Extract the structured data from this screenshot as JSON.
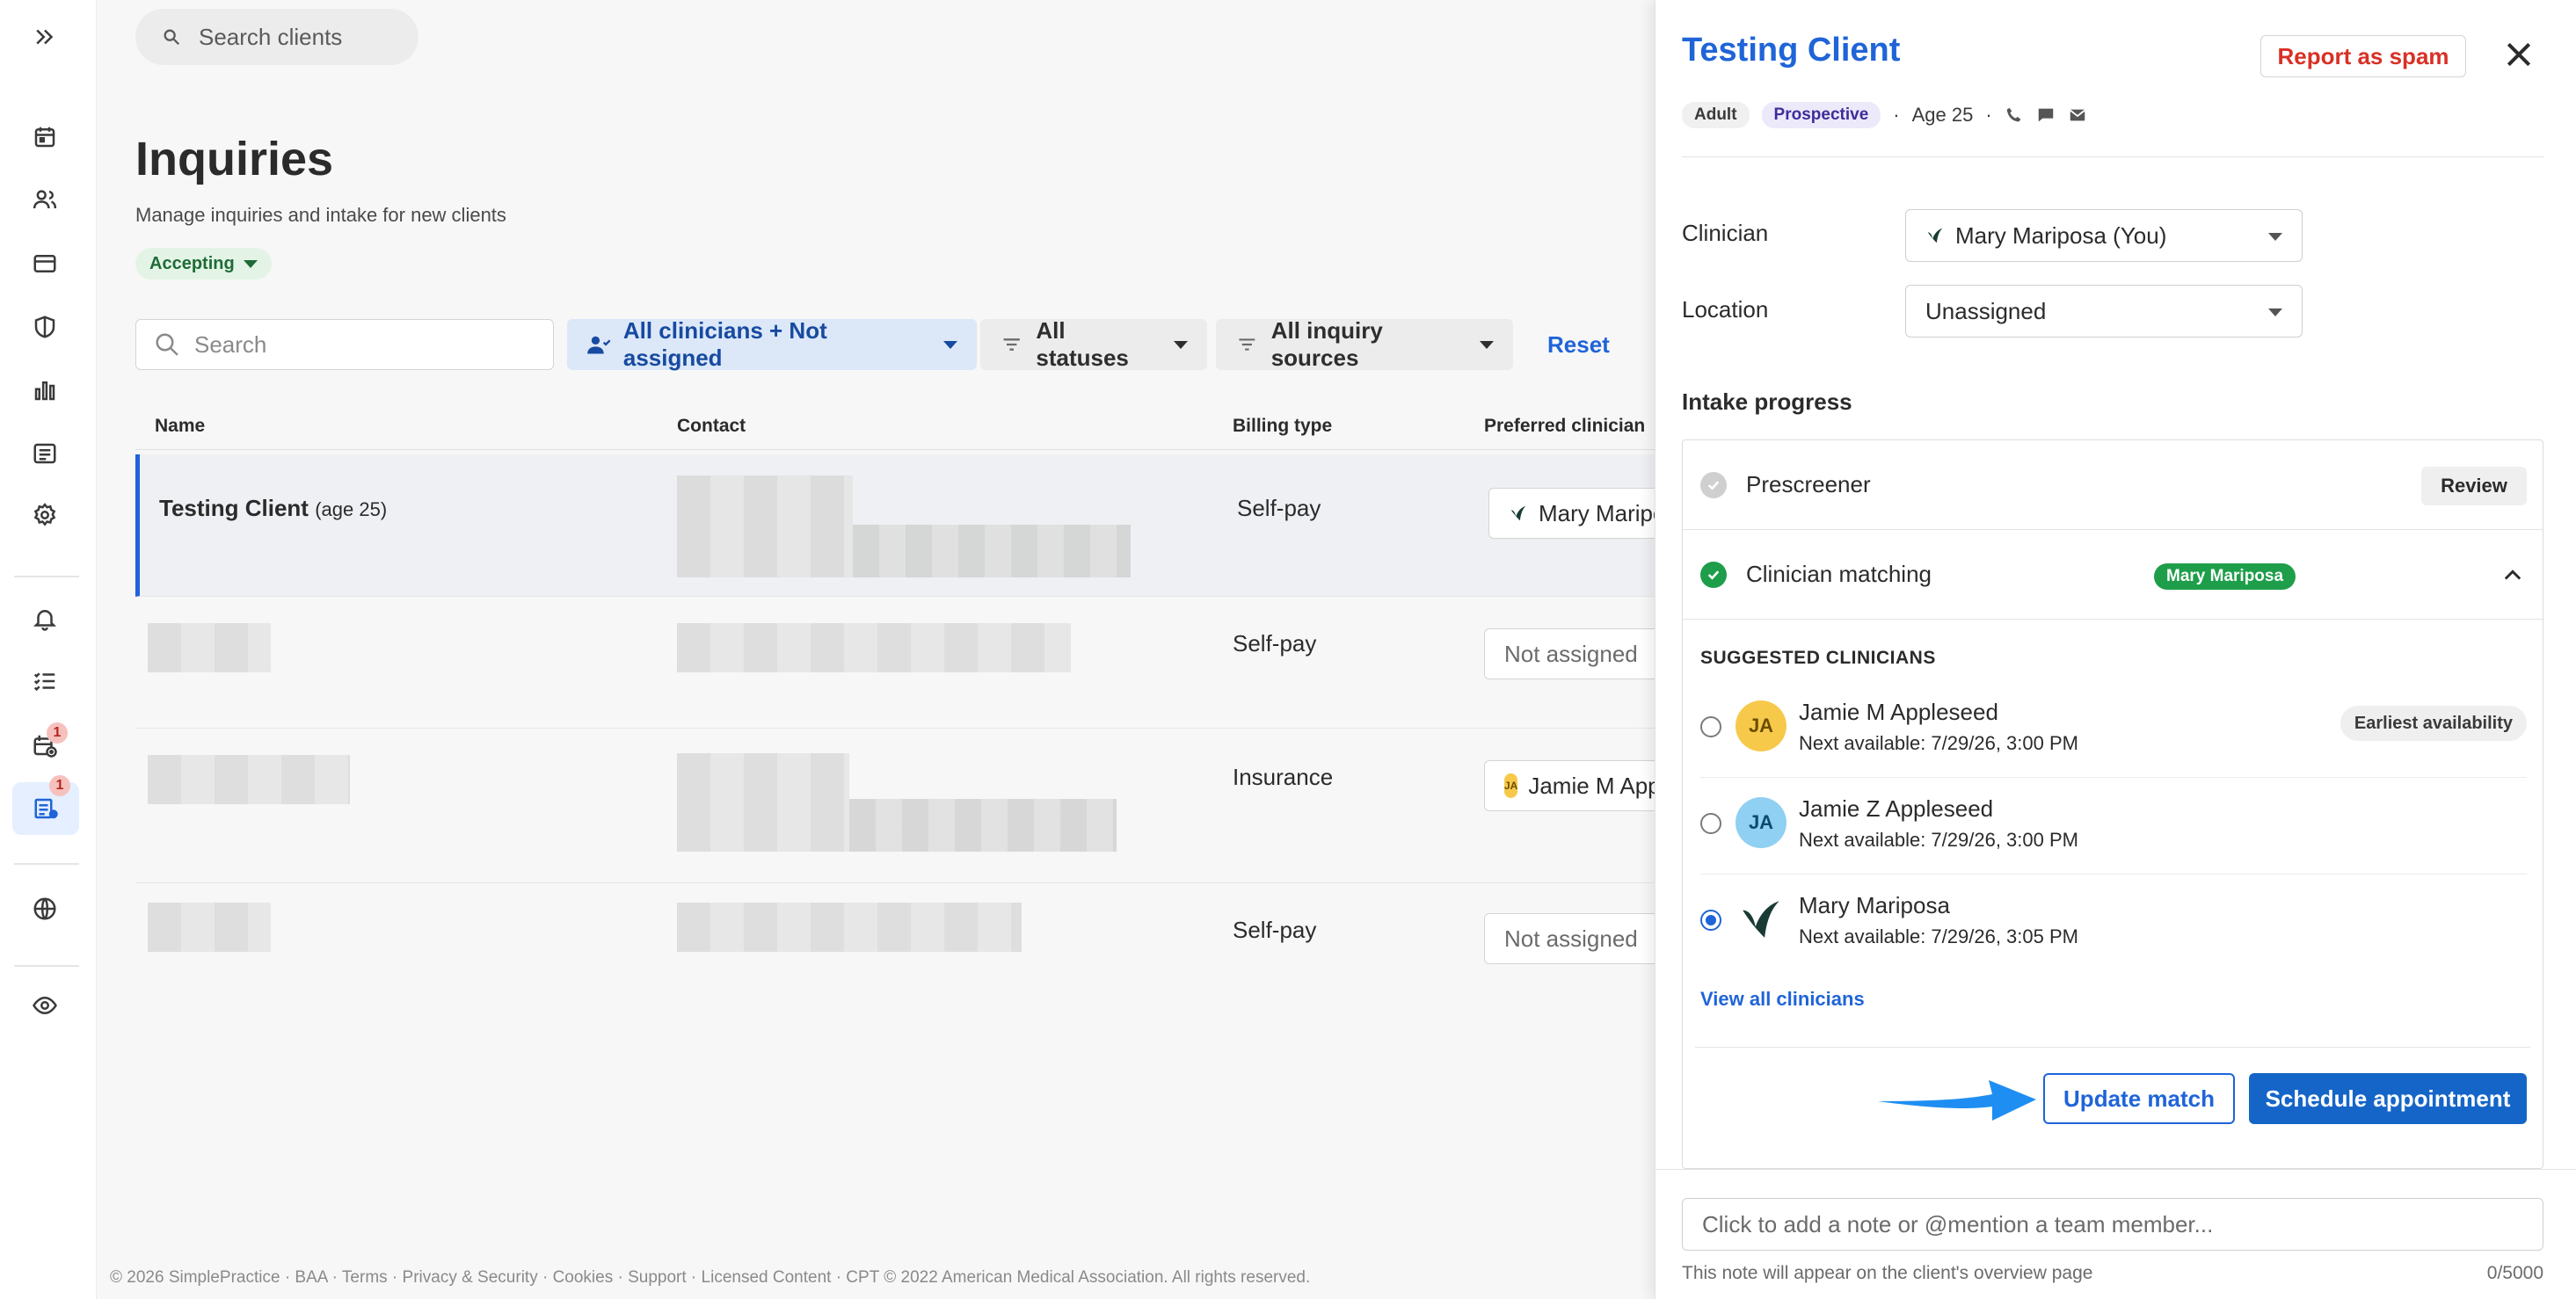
{
  "rail": {
    "items": [
      {
        "name": "expand-sidebar-icon"
      },
      {
        "name": "calendar-icon"
      },
      {
        "name": "clients-icon"
      },
      {
        "name": "billing-icon"
      },
      {
        "name": "insurance-icon"
      },
      {
        "name": "analytics-icon"
      },
      {
        "name": "documents-icon"
      },
      {
        "name": "settings-icon"
      },
      {
        "name": "notifications-icon"
      },
      {
        "name": "tasks-icon"
      },
      {
        "name": "requests-icon",
        "badge": "1"
      },
      {
        "name": "inquiries-icon",
        "badge": "1",
        "active": true
      },
      {
        "name": "website-icon"
      },
      {
        "name": "preview-icon"
      }
    ]
  },
  "topbar": {
    "search_placeholder": "Search clients"
  },
  "page": {
    "title": "Inquiries",
    "subtitle": "Manage inquiries and intake for new clients",
    "accepting_label": "Accepting"
  },
  "filters": {
    "search_placeholder": "Search",
    "clinicians": "All clinicians + Not assigned",
    "statuses": "All statuses",
    "sources": "All inquiry sources",
    "reset": "Reset"
  },
  "table": {
    "headers": [
      "Name",
      "Contact",
      "Billing type",
      "Preferred clinician"
    ],
    "rows": [
      {
        "name": "Testing Client",
        "age": "(age 25)",
        "billing": "Self-pay",
        "preferred": "Mary Mariposa",
        "selected": true
      },
      {
        "name": "",
        "age": "",
        "billing": "Self-pay",
        "preferred": "Not assigned"
      },
      {
        "name": "",
        "age": "",
        "billing": "Insurance",
        "preferred": "Jamie M Appleseed",
        "pref_initials": "JA"
      },
      {
        "name": "",
        "age": "",
        "billing": "Self-pay",
        "preferred": "Not assigned"
      }
    ]
  },
  "footer": "© 2026 SimplePractice · BAA · Terms · Privacy & Security · Cookies · Support · Licensed Content · CPT © 2022 American Medical Association. All rights reserved.",
  "panel": {
    "client_name": "Testing Client",
    "report_spam": "Report as spam",
    "tag_adult": "Adult",
    "tag_status": "Prospective",
    "age": "Age 25",
    "clinician_label": "Clinician",
    "clinician_value": "Mary Mariposa (You)",
    "location_label": "Location",
    "location_value": "Unassigned",
    "intake_title": "Intake progress",
    "prescreener": "Prescreener",
    "review": "Review",
    "clinician_matching": "Clinician matching",
    "matched": "Mary Mariposa",
    "suggested_title": "SUGGESTED CLINICIANS",
    "suggested": [
      {
        "name": "Jamie M Appleseed",
        "next": "Next available: 7/29/26, 3:00 PM",
        "initials": "JA",
        "tag": "Earliest availability",
        "checked": false
      },
      {
        "name": "Jamie Z Appleseed",
        "next": "Next available: 7/29/26, 3:00 PM",
        "initials": "JA",
        "tag": "",
        "checked": false
      },
      {
        "name": "Mary Mariposa",
        "next": "Next available: 7/29/26, 3:05 PM",
        "initials": "",
        "tag": "",
        "checked": true
      }
    ],
    "view_all": "View all clinicians",
    "update_match": "Update match",
    "schedule": "Schedule appointment",
    "note_placeholder": "Click to add a note or @mention a team member...",
    "note_help": "This note will appear on the client's overview page",
    "note_count": "0/5000"
  },
  "colors": {
    "accent": "#1f64d8",
    "success": "#1e9e4a",
    "danger": "#d93025"
  }
}
